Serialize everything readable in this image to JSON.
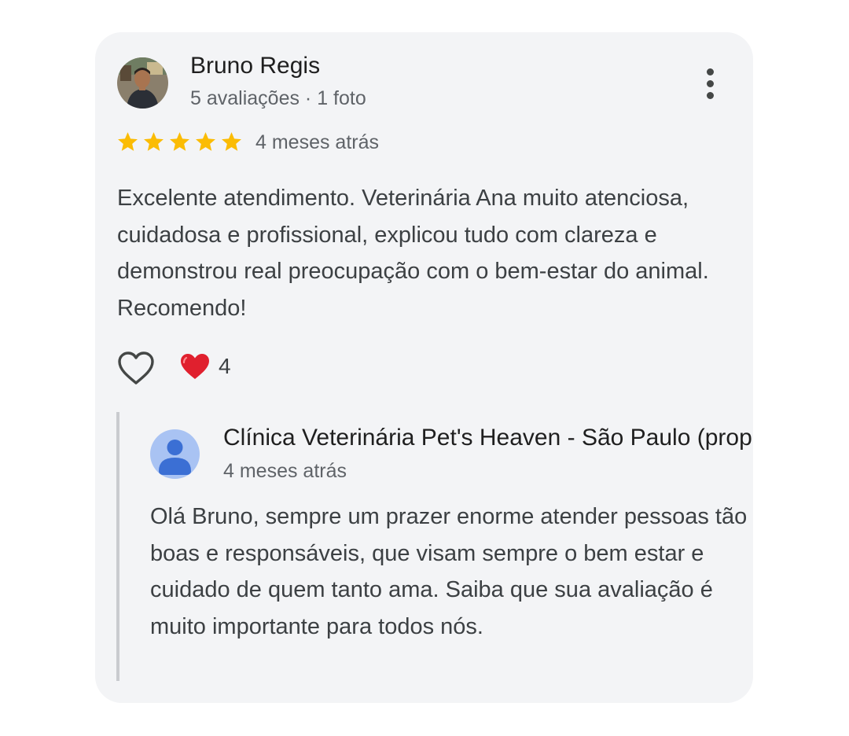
{
  "review": {
    "reviewer_name": "Bruno Regis",
    "reviewer_meta": "5 avaliações · 1 foto",
    "rating": 5,
    "rating_max": 5,
    "star_color": "#fbbc04",
    "date": "4 meses atrás",
    "text": "Excelente atendimento. Veterinária Ana muito atenciosa, cuidadosa e profissional, explicou tudo com clareza e demonstrou real preocupação com o bem-estar do animal. Recomendo!",
    "more_icon": "more-vert-icon",
    "like_icon": "heart-outline-icon",
    "reaction_icon": "red-heart-icon",
    "reaction_count": "4"
  },
  "owner_reply": {
    "name": "Clínica Veterinária Pet's Heaven - São Paulo (proprietário)",
    "date": "4 meses atrás",
    "avatar_icon": "default-person-icon",
    "text": "Olá Bruno, sempre um prazer enorme atender pessoas tão boas e responsáveis, que visam sempre o bem estar e cuidado de quem tanto ama. Saiba que sua avaliação é muito importante para todos nós."
  },
  "colors": {
    "card_background": "#f3f4f6",
    "heart_red": "#e0202e",
    "avatar_placeholder": "#a9c3f3",
    "avatar_person": "#3b6fd4"
  }
}
